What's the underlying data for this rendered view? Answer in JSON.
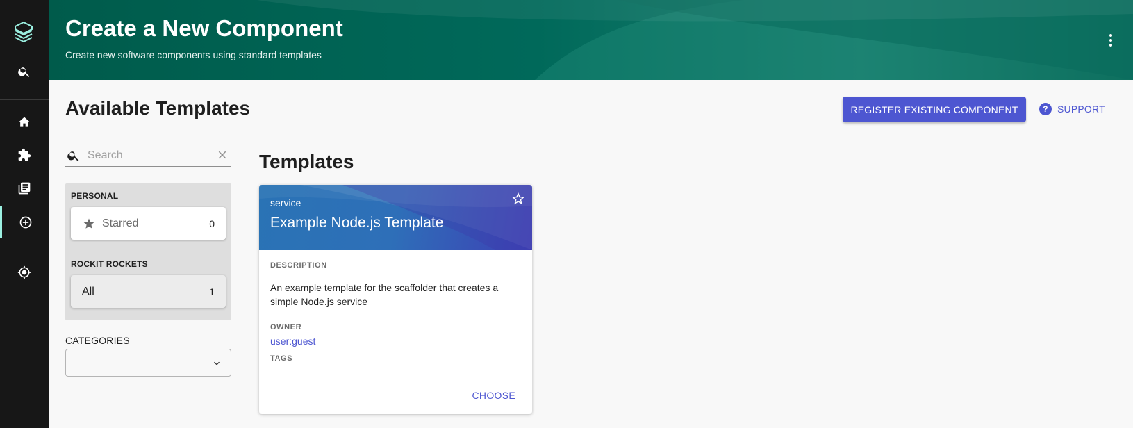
{
  "sidebar": {
    "logo_icon": "backstage-logo-icon",
    "items": [
      {
        "icon": "search-icon",
        "name": "sidebar-item-search"
      },
      {
        "icon": "home-icon",
        "name": "sidebar-item-home"
      },
      {
        "icon": "puzzle-icon",
        "name": "sidebar-item-apis"
      },
      {
        "icon": "docs-icon",
        "name": "sidebar-item-docs"
      },
      {
        "icon": "create-icon",
        "name": "sidebar-item-create",
        "active": true
      },
      {
        "icon": "radar-icon",
        "name": "sidebar-item-tech-radar"
      }
    ]
  },
  "header": {
    "title": "Create a New Component",
    "subtitle": "Create new software components using standard templates"
  },
  "content": {
    "title": "Available Templates",
    "register_label": "REGISTER EXISTING COMPONENT",
    "support_label": "SUPPORT"
  },
  "search": {
    "placeholder": "Search"
  },
  "filters": {
    "personal_label": "PERSONAL",
    "starred_label": "Starred",
    "starred_count": "0",
    "org_label": "ROCKIT ROCKETS",
    "all_label": "All",
    "all_count": "1"
  },
  "categories": {
    "label": "CATEGORIES",
    "selected": ""
  },
  "templates": {
    "title": "Templates",
    "cards": [
      {
        "type": "service",
        "title": "Example Node.js Template",
        "description_label": "DESCRIPTION",
        "description": "An example template for the scaffolder that creates a simple Node.js service",
        "owner_label": "OWNER",
        "owner": "user:guest",
        "tags_label": "TAGS",
        "choose_label": "CHOOSE"
      }
    ]
  },
  "colors": {
    "sidebar_bg": "#171717",
    "header_bg": "#005b4b",
    "primary": "#4d56d1",
    "active_indicator": "#9bf0e1"
  }
}
